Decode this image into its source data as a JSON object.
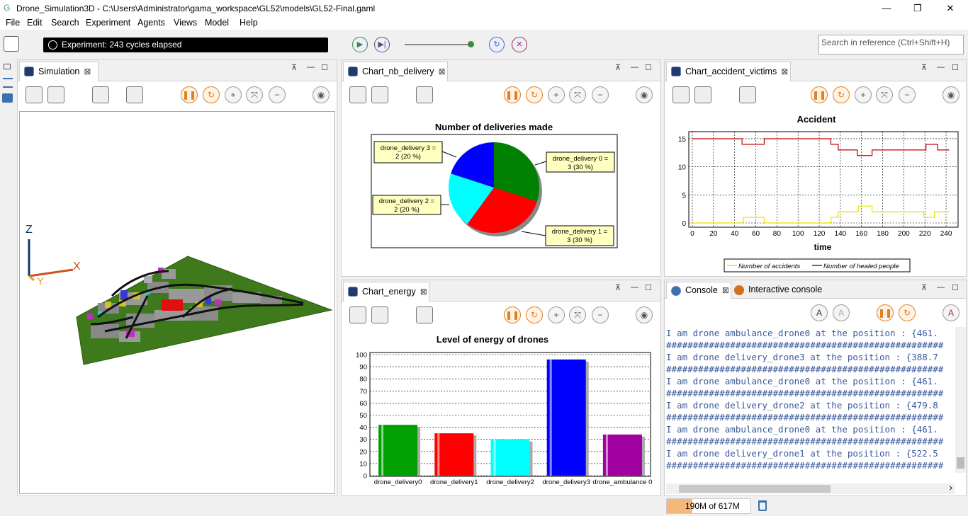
{
  "window": {
    "title": "Drone_Simulation3D - C:\\Users\\Administrator\\gama_workspace\\GL52\\models\\GL52-Final.gaml",
    "minimize": "—",
    "restore": "❐",
    "close": "✕"
  },
  "menu": [
    "File",
    "Edit",
    "Search",
    "Experiment",
    "Agents",
    "Views",
    "Model",
    "Help"
  ],
  "toolbar": {
    "experiment_status": "Experiment: 243 cycles elapsed",
    "search_placeholder": "Search in reference (Ctrl+Shift+H)"
  },
  "simulation": {
    "tab": "Simulation",
    "axis_z": "Z",
    "axis_x": "X",
    "axis_y": "Y"
  },
  "tabs": {
    "nb_delivery": "Chart_nb_delivery",
    "accident": "Chart_accident_victims",
    "energy": "Chart_energy",
    "console": "Console",
    "interactive": "Interactive console"
  },
  "chart_data": [
    {
      "type": "pie",
      "title": "Number of deliveries made",
      "slices": [
        {
          "name": "drone_delivery 0",
          "value": 3,
          "label": "3 (30 %)",
          "color": "#008000"
        },
        {
          "name": "drone_delivery 1",
          "value": 3,
          "label": "3 (30 %)",
          "color": "#ff0000"
        },
        {
          "name": "drone_delivery 2",
          "value": 2,
          "label": "2 (20 %)",
          "color": "#00ffff"
        },
        {
          "name": "drone_delivery 3",
          "value": 2,
          "label": "2 (20 %)",
          "color": "#0000ff"
        }
      ],
      "label_texts": [
        "drone_delivery 0 =",
        "3 (30 %)",
        "drone_delivery 1 =",
        "3 (30 %)",
        "drone_delivery 2 =",
        "2 (20 %)",
        "drone_delivery 3 =",
        "2 (20 %)"
      ]
    },
    {
      "type": "line",
      "title": "Accident",
      "xlabel": "time",
      "ylabel": "",
      "xlim": [
        0,
        248
      ],
      "ylim": [
        0,
        15.5
      ],
      "xticks": [
        "0",
        "20",
        "40",
        "60",
        "80",
        "100",
        "120",
        "140",
        "160",
        "180",
        "200",
        "220",
        "240"
      ],
      "yticks": [
        "0",
        "5",
        "10",
        "15"
      ],
      "grid": true,
      "series": [
        {
          "name": "Number of accidents",
          "color": "#e8e000",
          "x": [
            0,
            47,
            48,
            48,
            67,
            68,
            68,
            130,
            131,
            131,
            137,
            138,
            138,
            150,
            151,
            151,
            156,
            157,
            157,
            169,
            170,
            170,
            218,
            219,
            219,
            228,
            229,
            229,
            240,
            241,
            241,
            243
          ],
          "y": [
            0,
            0,
            0,
            1,
            1,
            1,
            0,
            0,
            0,
            1,
            1,
            1,
            2,
            2,
            2,
            2,
            2,
            2,
            3,
            3,
            3,
            2,
            2,
            2,
            1,
            1,
            1,
            2,
            2,
            2,
            2,
            2
          ]
        },
        {
          "name": "Number of healed people",
          "color": "#c00000",
          "x": [
            0,
            46,
            47,
            47,
            67,
            68,
            68,
            130,
            131,
            131,
            137,
            138,
            138,
            143,
            144,
            144,
            155,
            156,
            156,
            169,
            170,
            170,
            220,
            221,
            221,
            231,
            232,
            232,
            243
          ],
          "y": [
            15,
            15,
            15,
            14,
            14,
            14,
            15,
            15,
            15,
            14,
            14,
            14,
            13,
            13,
            13,
            13,
            13,
            13,
            12,
            12,
            12,
            13,
            13,
            13,
            14,
            14,
            14,
            13,
            13
          ]
        }
      ],
      "legend_position": "bottom"
    },
    {
      "type": "bar",
      "title": "Level of energy of drones",
      "categories": [
        "drone_delivery0",
        "drone_delivery1",
        "drone_delivery2",
        "drone_delivery3",
        "drone_ambulance 0"
      ],
      "values": [
        42,
        35,
        30,
        96,
        34
      ],
      "colors": [
        "#00a000",
        "#ff0000",
        "#00ffff",
        "#0000ff",
        "#a000a0"
      ],
      "ylim": [
        0,
        100
      ],
      "yticks": [
        "0",
        "10",
        "20",
        "30",
        "40",
        "50",
        "60",
        "70",
        "80",
        "90",
        "100"
      ],
      "grid": true
    }
  ],
  "console": {
    "lines": [
      "I am drone ambulance_drone0 at the position : {461.",
      "####################################################",
      "I am drone delivery_drone3 at the position : {388.7",
      "####################################################",
      "I am drone ambulance_drone0 at the position : {461.",
      "####################################################",
      "I am drone delivery_drone2 at the position : {479.8",
      "####################################################",
      "I am drone ambulance_drone0 at the position : {461.",
      "####################################################",
      "I am drone delivery_drone1 at the position : {522.5",
      "####################################################"
    ]
  },
  "status": {
    "memory": "190M of 617M"
  }
}
